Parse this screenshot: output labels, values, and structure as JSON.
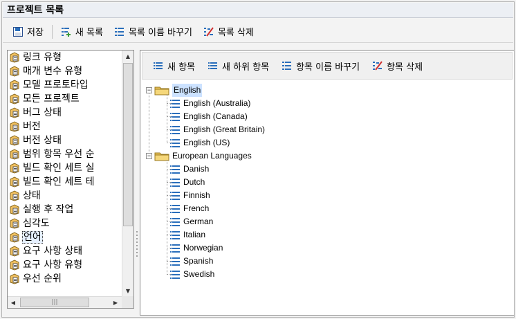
{
  "window": {
    "title": "프로젝트 목록"
  },
  "toolbar": {
    "save": "저장",
    "new_list": "새 목록",
    "rename_list": "목록 이름 바꾸기",
    "delete_list": "목록 삭제"
  },
  "left_list": {
    "items": [
      "링크 유형",
      "매개 변수 유형",
      "모델 프로토타입",
      "모든 프로젝트",
      "버그 상태",
      "버전",
      "버전 상태",
      "범위 항목 우선 순",
      "빌드 확인 세트 실",
      "빌드 확인 세트 테",
      "상태",
      "실행 후 작업",
      "심각도",
      "언어",
      "요구 사항 상태",
      "요구 사항 유형",
      "우선 순위"
    ],
    "selected": "언어"
  },
  "right_toolbar": {
    "new_item": "새 항목",
    "new_subitem": "새 하위 항목",
    "rename_item": "항목 이름 바꾸기",
    "delete_item": "항목 삭제"
  },
  "tree": {
    "groups": [
      {
        "label": "English",
        "expanded": true,
        "selected": true,
        "children": [
          "English (Australia)",
          "English (Canada)",
          "English (Great Britain)",
          "English (US)"
        ]
      },
      {
        "label": "European Languages",
        "expanded": true,
        "selected": false,
        "children": [
          "Danish",
          "Dutch",
          "Finnish",
          "French",
          "German",
          "Italian",
          "Norwegian",
          "Spanish",
          "Swedish"
        ]
      }
    ]
  },
  "icons": {
    "save": "save-icon",
    "new_list": "new-list-icon",
    "rename_list": "rename-list-icon",
    "delete_list": "delete-list-icon",
    "list_item": "list-icon",
    "folder": "folder-icon",
    "leaf": "tree-item-icon"
  },
  "colors": {
    "selection": "#cce2ff",
    "accent": "#2a6ebb",
    "folder": "#e8c15a"
  }
}
